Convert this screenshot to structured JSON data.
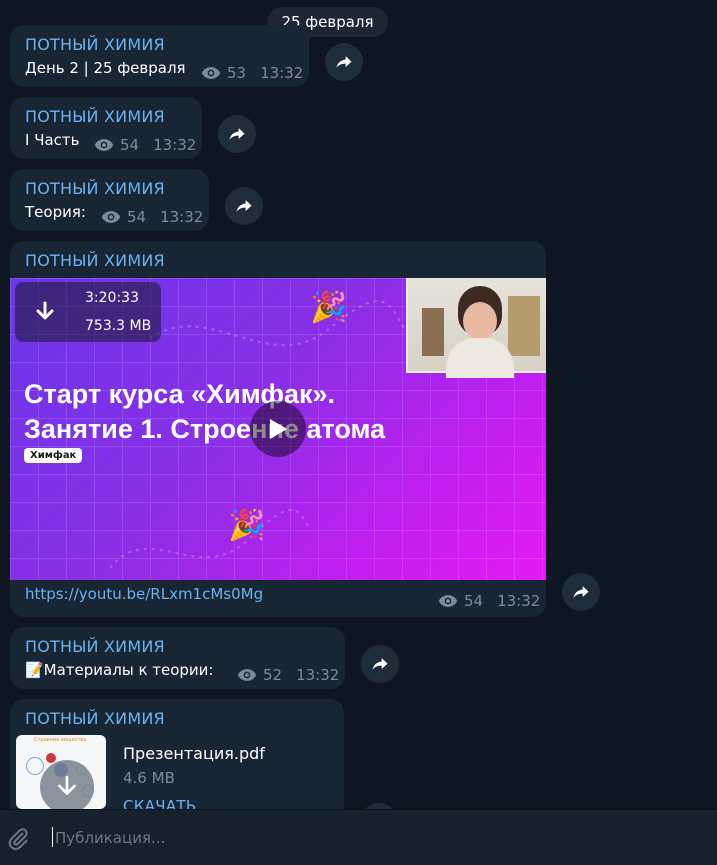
{
  "date_separator": "25 февраля",
  "channel_name": "ПОТНЫЙ ХИМИЯ",
  "messages": [
    {
      "text": "День 2 | 25 февраля",
      "views": "53",
      "time": "13:32"
    },
    {
      "text": "I Часть",
      "views": "54",
      "time": "13:32"
    },
    {
      "text": "Теория:",
      "views": "54",
      "time": "13:32"
    },
    {
      "video": {
        "duration": "3:20:33",
        "size": "753.3 MB",
        "title_line1": "Старт курса «Химфак».",
        "title_line2": "Занятие 1. Строение атома",
        "tag": "Химфак"
      },
      "link": "https://youtu.be/RLxm1cMs0Mg",
      "views": "54",
      "time": "13:32"
    },
    {
      "text": "📝Материалы к теории:",
      "views": "52",
      "time": "13:32"
    },
    {
      "document": {
        "name": "Презентация.pdf",
        "size": "4.6 MB",
        "action": "СКАЧАТЬ",
        "thumb_title": "Строение вещества"
      }
    }
  ],
  "composer": {
    "placeholder": "Публикация..."
  },
  "colors": {
    "background": "#0e1621",
    "bubble": "#182533",
    "accent": "#6ab3f3",
    "meta": "#7d8b99"
  },
  "icons": [
    "eye-icon",
    "forward-icon",
    "download-icon",
    "play-icon",
    "paperclip-icon"
  ]
}
